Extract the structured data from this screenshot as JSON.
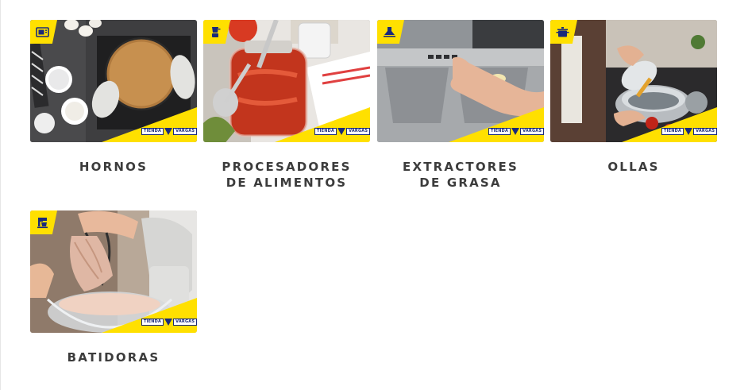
{
  "brand": {
    "left": "TIENDA",
    "right": "VARGAS",
    "color_yellow": "#ffe000",
    "color_navy": "#1a2a7a"
  },
  "categories": [
    {
      "label": "HORNOS",
      "icon": "microwave-oven-icon"
    },
    {
      "label": "PROCESADORES\nDE ALIMENTOS",
      "icon": "blender-icon"
    },
    {
      "label": "EXTRACTORES\nDE GRASA",
      "icon": "range-hood-icon"
    },
    {
      "label": "OLLAS",
      "icon": "cooking-pot-icon"
    },
    {
      "label": "BATIDORAS",
      "icon": "stand-mixer-icon"
    }
  ]
}
